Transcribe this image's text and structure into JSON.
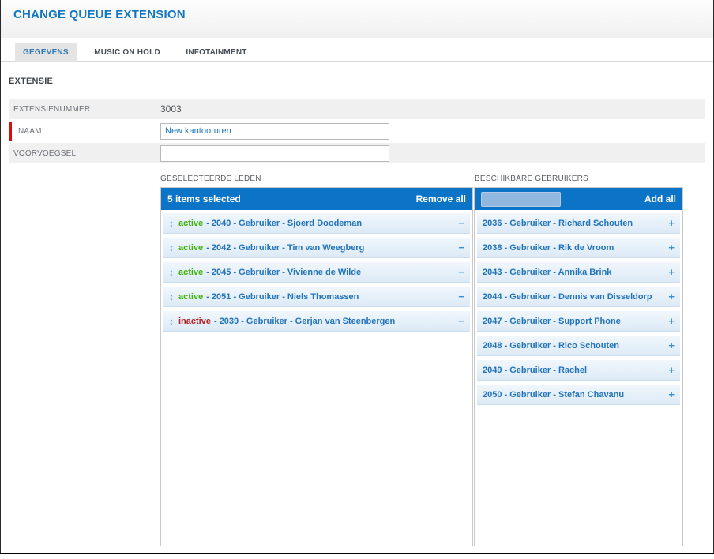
{
  "header": {
    "title": "CHANGE QUEUE EXTENSION"
  },
  "tabs": [
    {
      "label": "GEGEVENS",
      "active": true
    },
    {
      "label": "MUSIC ON HOLD",
      "active": false
    },
    {
      "label": "INFOTAINMENT",
      "active": false
    }
  ],
  "section": {
    "title": "EXTENSIE"
  },
  "fields": [
    {
      "label": "EXTENSIENUMMER",
      "value": "3003",
      "type": "readonly",
      "required": false
    },
    {
      "label": "NAAM",
      "value": "New kantooruren",
      "type": "text",
      "required": true
    },
    {
      "label": "VOORVOEGSEL",
      "value": "",
      "type": "text",
      "required": false
    }
  ],
  "selected_members": {
    "label": "GESELECTEERDE LEDEN",
    "header": {
      "count_text": "5 items selected",
      "action": "Remove all"
    },
    "items": [
      {
        "status": "active",
        "text": "- 2040 - Gebruiker - Sjoerd Doodeman"
      },
      {
        "status": "active",
        "text": "- 2042 - Gebruiker - Tim van Weegberg"
      },
      {
        "status": "active",
        "text": "- 2045 - Gebruiker - Vivienne de Wilde"
      },
      {
        "status": "active",
        "text": "- 2051 - Gebruiker - Niels Thomassen"
      },
      {
        "status": "inactive",
        "text": "- 2039 - Gebruiker - Gerjan van Steenbergen"
      }
    ]
  },
  "available_users": {
    "label": "BESCHIKBARE GEBRUIKERS",
    "header": {
      "search_value": "",
      "action": "Add all"
    },
    "items": [
      {
        "text": "2036 - Gebruiker - Richard Schouten"
      },
      {
        "text": "2038 - Gebruiker - Rik de Vroom"
      },
      {
        "text": "2043 - Gebruiker - Annika Brink"
      },
      {
        "text": "2044 - Gebruiker - Dennis van Disseldorp"
      },
      {
        "text": "2047 - Gebruiker - Support Phone"
      },
      {
        "text": "2048 - Gebruiker - Rico Schouten"
      },
      {
        "text": "2049 - Gebruiker - Rachel"
      },
      {
        "text": "2050 - Gebruiker - Stefan Chavanu"
      }
    ]
  },
  "icons": {
    "drag_handle": "↕",
    "remove": "−",
    "add": "+"
  },
  "colors": {
    "accent_blue": "#0c74c6",
    "title_blue": "#1178c0",
    "item_text_blue": "#2173ba",
    "status_active_green": "#3cb30a",
    "status_inactive_red": "#b42025",
    "required_red": "#dd0c0c"
  }
}
